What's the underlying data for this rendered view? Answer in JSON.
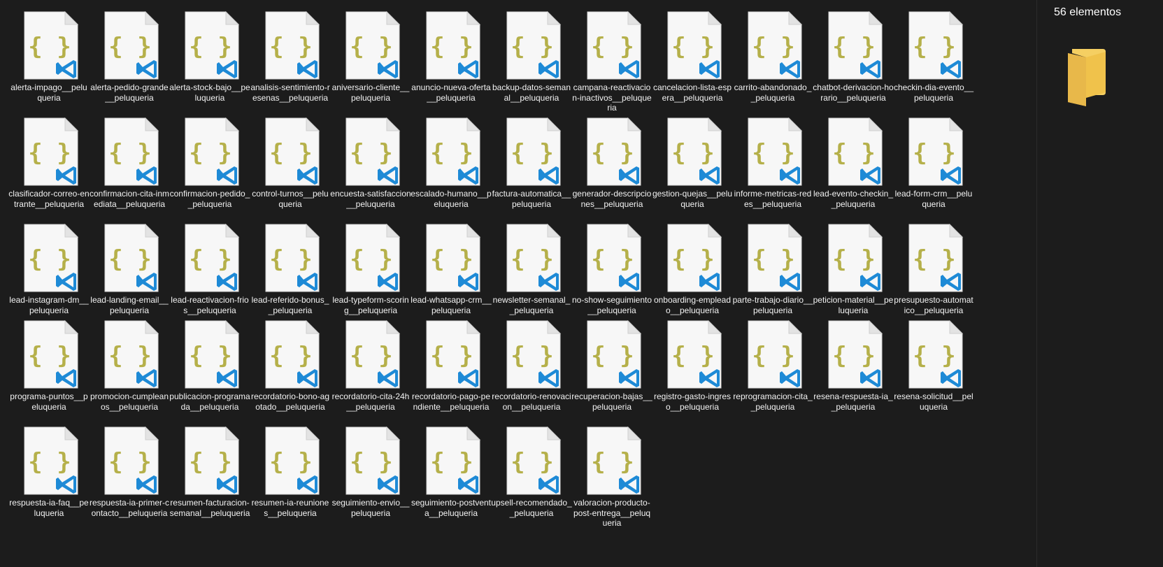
{
  "status": {
    "count_label": "56 elementos"
  },
  "preview": {
    "icon": "folder-icon",
    "folder_color": "#f0c24b"
  },
  "file_icon": {
    "name": "json-vscode-file-icon",
    "brace_color": "#b5b04a",
    "badge_color": "#1e8ad6",
    "page_color": "#f7f7f7"
  },
  "files": [
    "alerta-impago__peluqueria",
    "alerta-pedido-grande__peluqueria",
    "alerta-stock-bajo__peluqueria",
    "analisis-sentimiento-resenas__peluqueria",
    "aniversario-cliente__peluqueria",
    "anuncio-nueva-oferta__peluqueria",
    "backup-datos-semanal__peluqueria",
    "campana-reactivacion-inactivos__peluqueria",
    "cancelacion-lista-espera__peluqueria",
    "carrito-abandonado__peluqueria",
    "chatbot-derivacion-horario__peluqueria",
    "checkin-dia-evento__peluqueria",
    "clasificador-correo-entrante__peluqueria",
    "confirmacion-cita-inmediata__peluqueria",
    "confirmacion-pedido__peluqueria",
    "control-turnos__peluqueria",
    "encuesta-satisfaccion__peluqueria",
    "escalado-humano__peluqueria",
    "factura-automatica__peluqueria",
    "generador-descripciones__peluqueria",
    "gestion-quejas__peluqueria",
    "informe-metricas-redes__peluqueria",
    "lead-evento-checkin__peluqueria",
    "lead-form-crm__peluqueria",
    "lead-instagram-dm__peluqueria",
    "lead-landing-email__peluqueria",
    "lead-reactivacion-frios__peluqueria",
    "lead-referido-bonus__peluqueria",
    "lead-typeform-scoring__peluqueria",
    "lead-whatsapp-crm__peluqueria",
    "newsletter-semanal__peluqueria",
    "no-show-seguimiento__peluqueria",
    "onboarding-empleado__peluqueria",
    "parte-trabajo-diario__peluqueria",
    "peticion-material__peluqueria",
    "presupuesto-automatico__peluqueria",
    "programa-puntos__peluqueria",
    "promocion-cumpleanos__peluqueria",
    "publicacion-programada__peluqueria",
    "recordatorio-bono-agotado__peluqueria",
    "recordatorio-cita-24h__peluqueria",
    "recordatorio-pago-pendiente__peluqueria",
    "recordatorio-renovacion__peluqueria",
    "recuperacion-bajas__peluqueria",
    "registro-gasto-ingreso__peluqueria",
    "reprogramacion-cita__peluqueria",
    "resena-respuesta-ia__peluqueria",
    "resena-solicitud__peluqueria",
    "respuesta-ia-faq__peluqueria",
    "respuesta-ia-primer-contacto__peluqueria",
    "resumen-facturacion-semanal__peluqueria",
    "resumen-ia-reuniones__peluqueria",
    "seguimiento-envio__peluqueria",
    "seguimiento-postventa__peluqueria",
    "upsell-recomendado__peluqueria",
    "valoracion-producto-post-entrega__peluqueria"
  ]
}
